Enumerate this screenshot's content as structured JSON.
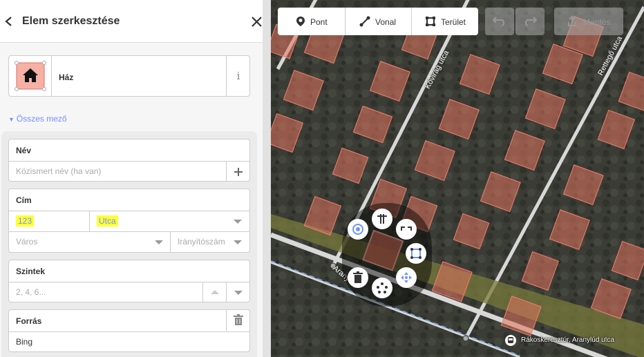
{
  "sidebar": {
    "title": "Elem szerkesztése",
    "preset": {
      "name": "Ház",
      "info": "i"
    },
    "all_fields_label": "Összes mező",
    "fields": {
      "name": {
        "label": "Név",
        "placeholder": "Közismert név (ha van)"
      },
      "address": {
        "label": "Cím",
        "housenumber": "123",
        "street": "Utca",
        "city_placeholder": "Város",
        "postcode_placeholder": "Irányítószám"
      },
      "levels": {
        "label": "Szintek",
        "placeholder": "2, 4, 6..."
      },
      "source": {
        "label": "Forrás",
        "value": "Bing"
      }
    }
  },
  "toolbar": {
    "point_label": "Pont",
    "line_label": "Vonal",
    "area_label": "Terület",
    "save_label": "Mentés"
  },
  "map": {
    "street_labels": [
      "Kővirág utca",
      "Rettegő utca",
      "Aranylúd"
    ],
    "bus_stop_label": "Rákoskeresztúr, Aranylúd utca"
  },
  "colors": {
    "accent": "#7092ff",
    "building_fill": "#e06e5f",
    "highlight": "#ffff37"
  }
}
